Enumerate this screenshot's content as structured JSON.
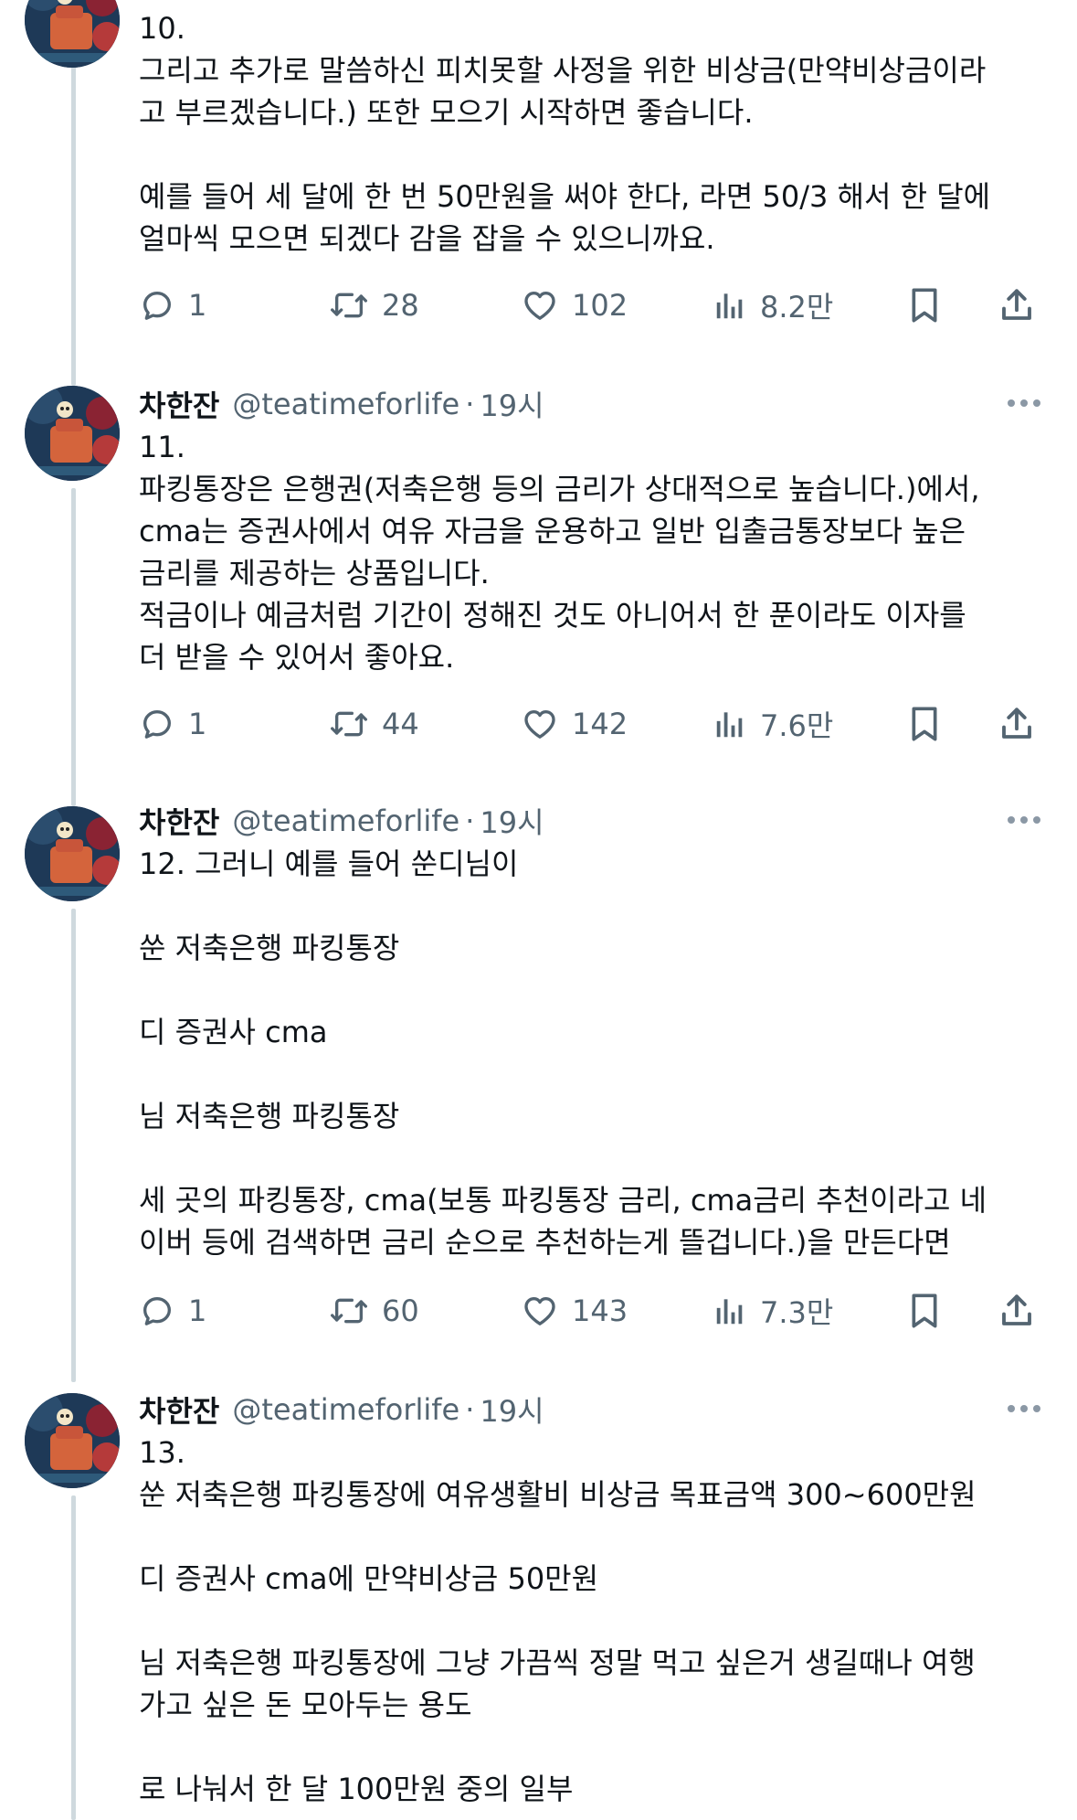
{
  "tweets": [
    {
      "header": null,
      "body": "10.\n그리고 추가로 말씀하신 피치못할 사정을 위한 비상금(만약비상금이라\n고 부르겠습니다.) 또한 모으기 시작하면 좋습니다.\n\n예를 들어 세 달에 한 번 50만원을 써야 한다, 라면 50/3 해서 한 달에\n얼마씩 모으면 되겠다 감을 잡을 수 있으니까요.",
      "replies": "1",
      "retweets": "28",
      "likes": "102",
      "views": "8.2만"
    },
    {
      "header": {
        "name": "차한잔",
        "handle": "@teatimeforlife",
        "dot": "·",
        "time": "19시"
      },
      "body": "11.\n파킹통장은 은행권(저축은행 등의 금리가 상대적으로 높습니다.)에서,\ncma는 증권사에서 여유 자금을 운용하고 일반 입출금통장보다 높은\n금리를 제공하는 상품입니다.\n적금이나 예금처럼 기간이 정해진 것도 아니어서 한 푼이라도 이자를\n더 받을 수 있어서 좋아요.",
      "replies": "1",
      "retweets": "44",
      "likes": "142",
      "views": "7.6만"
    },
    {
      "header": {
        "name": "차한잔",
        "handle": "@teatimeforlife",
        "dot": "·",
        "time": "19시"
      },
      "body": "12. 그러니 예를 들어 쑨디님이\n\n쑨 저축은행 파킹통장\n\n디 증권사 cma\n\n님 저축은행 파킹통장\n\n세 곳의 파킹통장, cma(보통 파킹통장 금리, cma금리 추천이라고 네\n이버 등에 검색하면 금리 순으로 추천하는게 뜰겁니다.)을 만든다면",
      "replies": "1",
      "retweets": "60",
      "likes": "143",
      "views": "7.3만"
    },
    {
      "header": {
        "name": "차한잔",
        "handle": "@teatimeforlife",
        "dot": "·",
        "time": "19시"
      },
      "body": "13.\n쑨 저축은행 파킹통장에 여유생활비 비상금 목표금액 300~600만원\n\n디 증권사 cma에 만약비상금 50만원\n\n님 저축은행 파킹통장에 그냥 가끔씩 정말 먹고 싶은거 생길때나 여행\n가고 싶은 돈 모아두는 용도\n\n로 나눠서 한 달 100만원 중의 일부",
      "replies": null,
      "retweets": null,
      "likes": null,
      "views": null
    }
  ],
  "icons": {
    "reply": "reply-icon",
    "retweet": "retweet-icon",
    "like": "heart-icon",
    "views": "views-icon",
    "bookmark": "bookmark-icon",
    "share": "share-icon",
    "more": "more-icon"
  },
  "colors": {
    "text": "#0f1419",
    "muted": "#536471",
    "thread": "#cfd9de"
  }
}
